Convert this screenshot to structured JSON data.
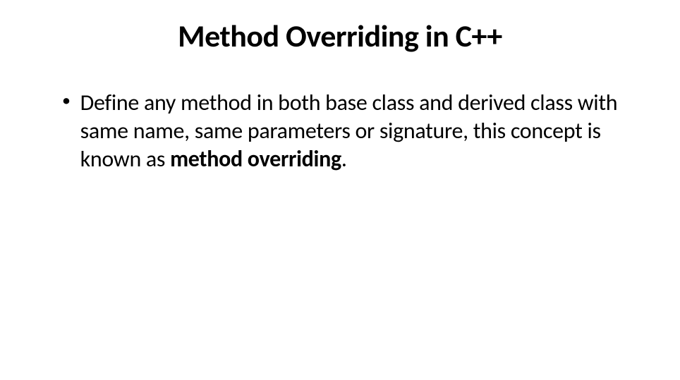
{
  "slide": {
    "title": "Method Overriding in C++",
    "bullets": [
      {
        "text_part1": "Define any method in both base class and derived class with same name, same parameters or signature, this concept is known as ",
        "bold_part": "method overriding",
        "text_part2": "."
      }
    ]
  }
}
